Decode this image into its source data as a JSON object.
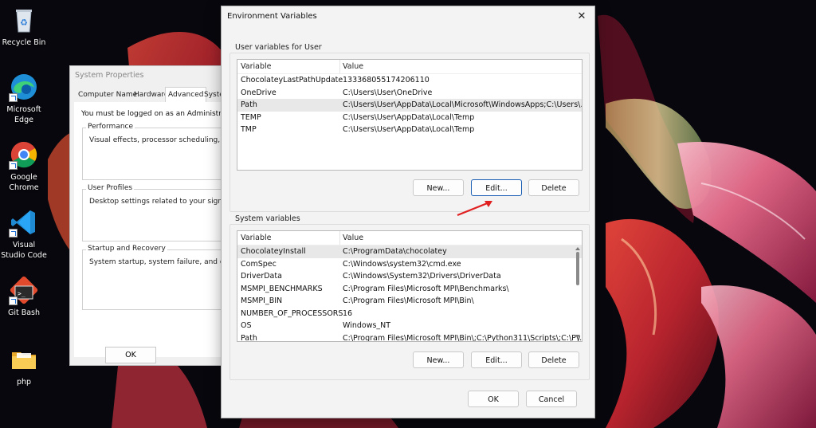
{
  "desktop": {
    "icons": [
      {
        "label": "Recycle Bin",
        "icon": "recycle-bin-icon"
      },
      {
        "label": "Microsoft Edge",
        "icon": "edge-icon"
      },
      {
        "label": "Google Chrome",
        "icon": "chrome-icon"
      },
      {
        "label": "Visual Studio Code",
        "icon": "vscode-icon"
      },
      {
        "label": "Git Bash",
        "icon": "git-bash-icon"
      },
      {
        "label": "php",
        "icon": "folder-icon"
      }
    ]
  },
  "system_properties": {
    "title": "System Properties",
    "tabs": [
      "Computer Name",
      "Hardware",
      "Advanced",
      "System"
    ],
    "active_tab": "Advanced",
    "admin_note": "You must be logged on as an Administrator to",
    "groups": [
      {
        "title": "Performance",
        "description": "Visual effects, processor scheduling, memor"
      },
      {
        "title": "User Profiles",
        "description": "Desktop settings related to your sign-in"
      },
      {
        "title": "Startup and Recovery",
        "description": "System startup, system failure, and debuggi"
      }
    ],
    "ok_label": "OK"
  },
  "env_dialog": {
    "title": "Environment Variables",
    "close_glyph": "✕",
    "user_section_title": "User variables for User",
    "system_section_title": "System variables",
    "col_variable": "Variable",
    "col_value": "Value",
    "user_vars": [
      {
        "name": "ChocolateyLastPathUpdate",
        "value": "133368055174206110"
      },
      {
        "name": "OneDrive",
        "value": "C:\\Users\\User\\OneDrive"
      },
      {
        "name": "Path",
        "value": "C:\\Users\\User\\AppData\\Local\\Microsoft\\WindowsApps;C:\\Users\\..."
      },
      {
        "name": "TEMP",
        "value": "C:\\Users\\User\\AppData\\Local\\Temp"
      },
      {
        "name": "TMP",
        "value": "C:\\Users\\User\\AppData\\Local\\Temp"
      }
    ],
    "system_vars": [
      {
        "name": "ChocolateyInstall",
        "value": "C:\\ProgramData\\chocolatey"
      },
      {
        "name": "ComSpec",
        "value": "C:\\Windows\\system32\\cmd.exe"
      },
      {
        "name": "DriverData",
        "value": "C:\\Windows\\System32\\Drivers\\DriverData"
      },
      {
        "name": "MSMPI_BENCHMARKS",
        "value": "C:\\Program Files\\Microsoft MPI\\Benchmarks\\"
      },
      {
        "name": "MSMPI_BIN",
        "value": "C:\\Program Files\\Microsoft MPI\\Bin\\"
      },
      {
        "name": "NUMBER_OF_PROCESSORS",
        "value": "16"
      },
      {
        "name": "OS",
        "value": "Windows_NT"
      },
      {
        "name": "Path",
        "value": "C:\\Program Files\\Microsoft MPI\\Bin\\;C:\\Python311\\Scripts\\;C:\\Py..."
      }
    ],
    "user_buttons": {
      "new": "New...",
      "edit": "Edit...",
      "delete": "Delete"
    },
    "system_buttons": {
      "new": "New...",
      "edit": "Edit...",
      "delete": "Delete"
    },
    "ok_label": "OK",
    "cancel_label": "Cancel"
  },
  "colors": {
    "accent_focus": "#1a5fb4",
    "annotation_arrow": "#e02020",
    "selected_row": "#e8e8e8"
  }
}
